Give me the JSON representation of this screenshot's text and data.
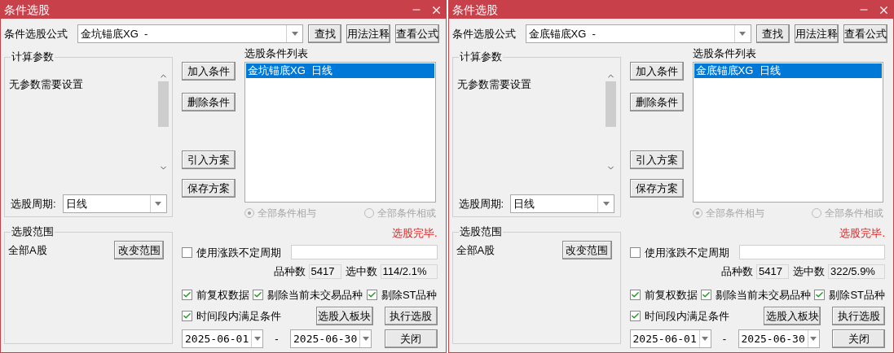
{
  "windows": [
    {
      "title": "条件选股",
      "formula_label": "条件选股公式",
      "formula_value": "金坑锚底XG  -",
      "top_buttons": [
        "查找",
        "用法注释",
        "查看公式"
      ],
      "params_title": "计算参数",
      "params_text": "无参数需要设置",
      "period_label": "选股周期:",
      "period_value": "日线",
      "condition_buttons": [
        "加入条件",
        "删除条件"
      ],
      "plan_buttons": [
        "引入方案",
        "保存方案"
      ],
      "list_title": "选股条件列表",
      "list_items": [
        {
          "text": "金坑锚底XG  日线",
          "selected": true
        }
      ],
      "radios": [
        {
          "label": "全部条件相与",
          "selected": true,
          "disabled": true
        },
        {
          "label": "全部条件相或",
          "selected": false,
          "disabled": true
        }
      ],
      "range_title": "选股范围",
      "range_value": "全部A股",
      "range_button": "改变范围",
      "status": "选股完毕.",
      "variable_period": {
        "label": "使用涨跌不定周期",
        "checked": false
      },
      "counts": [
        {
          "label": "品种数",
          "value": "5417"
        },
        {
          "label": "选中数",
          "value": "114/2.1%"
        }
      ],
      "checkboxes": [
        {
          "label": "前复权数据",
          "checked": true
        },
        {
          "label": "剔除当前未交易品种",
          "checked": true
        },
        {
          "label": "剔除ST品种",
          "checked": true
        }
      ],
      "time_checkbox": {
        "label": "时间段内满足条件",
        "checked": true
      },
      "action_buttons": [
        "选股入板块",
        "执行选股"
      ],
      "date_from": "2025-06-01",
      "dash": "-",
      "date_to": "2025-06-30",
      "close_button": "关闭"
    },
    {
      "title": "条件选股",
      "formula_label": "条件选股公式",
      "formula_value": "金底锚底XG  -",
      "top_buttons": [
        "查找",
        "用法注释",
        "查看公式"
      ],
      "params_title": "计算参数",
      "params_text": "无参数需要设置",
      "period_label": "选股周期:",
      "period_value": "日线",
      "condition_buttons": [
        "加入条件",
        "删除条件"
      ],
      "plan_buttons": [
        "引入方案",
        "保存方案"
      ],
      "list_title": "选股条件列表",
      "list_items": [
        {
          "text": "金底锚底XG  日线",
          "selected": true
        }
      ],
      "radios": [
        {
          "label": "全部条件相与",
          "selected": true,
          "disabled": true
        },
        {
          "label": "全部条件相或",
          "selected": false,
          "disabled": true
        }
      ],
      "range_title": "选股范围",
      "range_value": "全部A股",
      "range_button": "改变范围",
      "status": "选股完毕.",
      "variable_period": {
        "label": "使用涨跌不定周期",
        "checked": false
      },
      "counts": [
        {
          "label": "品种数",
          "value": "5417"
        },
        {
          "label": "选中数",
          "value": "322/5.9%"
        }
      ],
      "checkboxes": [
        {
          "label": "前复权数据",
          "checked": true
        },
        {
          "label": "剔除当前未交易品种",
          "checked": true
        },
        {
          "label": "剔除ST品种",
          "checked": true
        }
      ],
      "time_checkbox": {
        "label": "时间段内满足条件",
        "checked": true
      },
      "action_buttons": [
        "选股入板块",
        "执行选股"
      ],
      "date_from": "2025-06-01",
      "dash": "-",
      "date_to": "2025-06-30",
      "close_button": "关闭"
    }
  ]
}
